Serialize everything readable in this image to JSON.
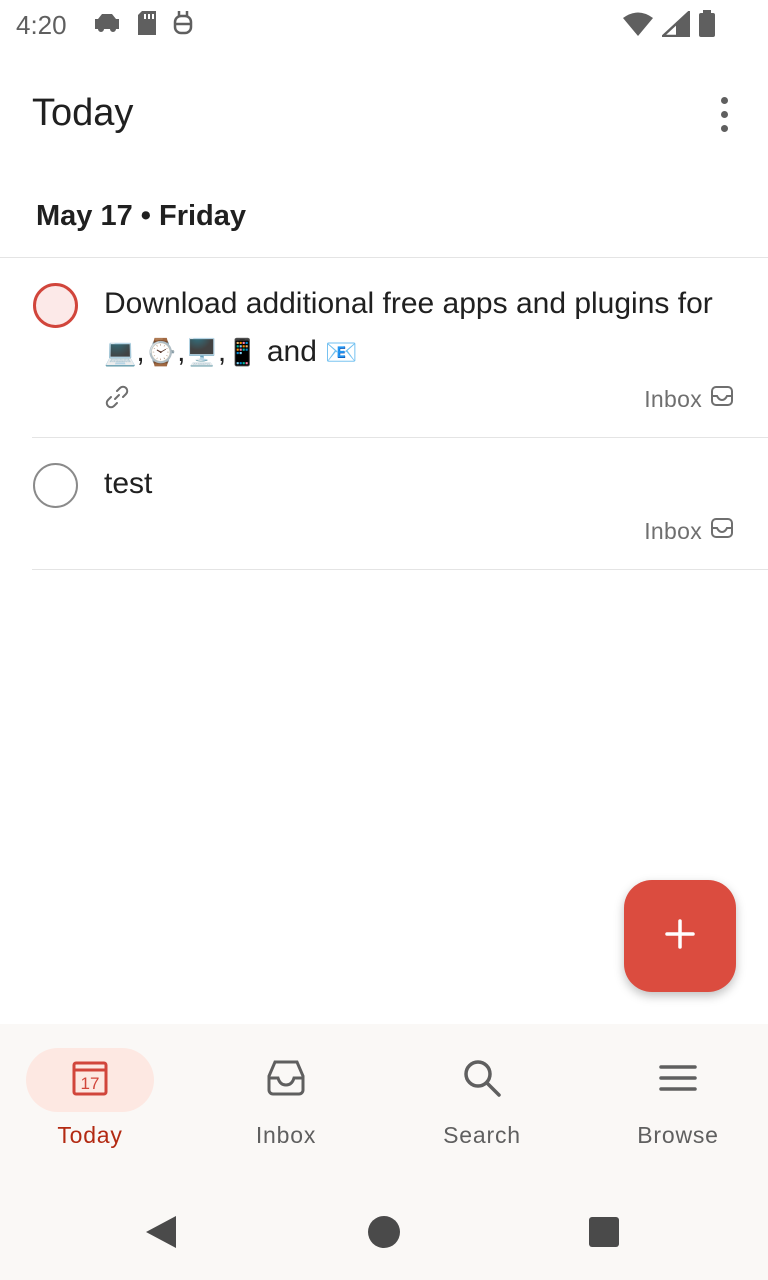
{
  "status_bar": {
    "time": "4:20",
    "left_icons": [
      "car-icon",
      "sd-card-icon",
      "robot-icon"
    ],
    "right_icons": [
      "wifi-icon",
      "cell-signal-icon",
      "battery-icon"
    ]
  },
  "header": {
    "title": "Today",
    "menu_icon": "more-vertical-icon"
  },
  "section": {
    "title": "May 17 • Friday"
  },
  "tasks": [
    {
      "text_prefix": "Download additional free apps and plugins for ",
      "emojis": [
        "💻",
        "⌚",
        "🖥️",
        "📱"
      ],
      "text_mid": " and ",
      "emoji_end": "📧",
      "has_link": true,
      "project": "Inbox",
      "priority_color": "#d1453b"
    },
    {
      "text": "test",
      "project": "Inbox"
    }
  ],
  "fab": {
    "icon": "plus-icon",
    "color": "#db4c3f"
  },
  "bottom_nav": {
    "items": [
      {
        "label": "Today",
        "icon": "calendar-17-icon",
        "active": true
      },
      {
        "label": "Inbox",
        "icon": "inbox-icon",
        "active": false
      },
      {
        "label": "Search",
        "icon": "search-icon",
        "active": false
      },
      {
        "label": "Browse",
        "icon": "menu-lines-icon",
        "active": false
      }
    ]
  },
  "colors": {
    "accent": "#db4c3f",
    "active_nav_text": "#b32a12",
    "active_nav_pill": "#fde8e2"
  }
}
